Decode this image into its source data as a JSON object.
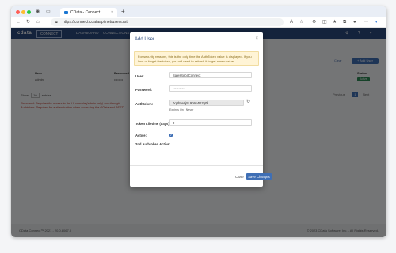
{
  "browser": {
    "tab_title": "CData - Connect",
    "url": "https://connect.cdataapi.net/users.rst",
    "new_tab": "+",
    "tab_close": "×"
  },
  "app": {
    "logo_main": "cdata",
    "logo_sub": "CONNECT",
    "menu": [
      "DASHBOARD",
      "CONNECTIONS"
    ],
    "add_button": "+ Add User",
    "clear_link": "Clear",
    "table": {
      "headers": [
        "User",
        "Password",
        "Status"
      ],
      "row": {
        "user": "admin",
        "password": "••••••••",
        "status": "Active"
      }
    },
    "show_label": "Show",
    "show_value": "10",
    "show_suffix": "entries",
    "pager_prev": "Previous",
    "pager_current": "1",
    "pager_next": "Next",
    "notes": [
      "Password: Required for access to the UI console (admin only) and through ...",
      "Authtoken: Required for authentication when accessing the OData and REST ..."
    ],
    "footer_left": "CData Connect™ 2021 - 20.0.8067.0",
    "footer_right": "© 2023 CData Software, Inc. - All Rights Reserved."
  },
  "modal": {
    "title": "Add User",
    "alert": "For security reasons, this is the only time the AuthToken value is displayed. If you lose or forget the token, you will need to refresh it to get a new value.",
    "fields": {
      "user_label": "User:",
      "user_value": "SalesforceConnect",
      "password_label": "Password:",
      "password_value": "••••••••••",
      "authtoken_label": "Authtoken:",
      "authtoken_value": "0q8h5e9j5L9h9k4D7g0l",
      "expires": "Expires On : Never",
      "lifetime_label": "Token Lifetime (days):",
      "lifetime_value": "0",
      "active_label": "Active:",
      "auth2_label": "2nd Authtoken Active:"
    },
    "close_button": "Close",
    "save_button": "Save Changes"
  },
  "colors": {
    "header_bg": "#2b4a7e",
    "primary": "#3f6fb5",
    "status_active": "#2e8b57",
    "warning_bg": "#fff4d6"
  }
}
